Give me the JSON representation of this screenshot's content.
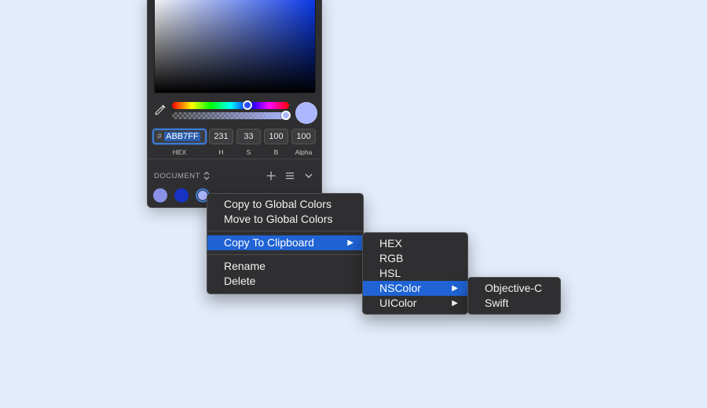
{
  "colors": {
    "background": "#e3ecfb",
    "panel": "#2f2f31",
    "current_color": "#abb7ff",
    "selection": "#1f63d4"
  },
  "picker": {
    "eyedropper_icon": "eyedropper-icon",
    "fields": {
      "hex_prefix": "#",
      "hex_value": "ABB7FF",
      "h_value": "231",
      "s_value": "33",
      "b_value": "100",
      "alpha_value": "100"
    },
    "labels": {
      "hex": "HEX",
      "h": "H",
      "s": "S",
      "b": "B",
      "alpha": "Alpha"
    }
  },
  "palette": {
    "label": "DOCUMENT",
    "swatches": [
      "#8a91e6",
      "#1832c4",
      "#abb7ff"
    ]
  },
  "context_menu": {
    "items": [
      "Copy to Global Colors",
      "Move to Global Colors",
      "Copy To Clipboard",
      "Rename",
      "Delete"
    ]
  },
  "clipboard_submenu": {
    "items": [
      "HEX",
      "RGB",
      "HSL",
      "NSColor",
      "UIColor"
    ]
  },
  "nscolor_submenu": {
    "items": [
      "Objective-C",
      "Swift"
    ]
  }
}
